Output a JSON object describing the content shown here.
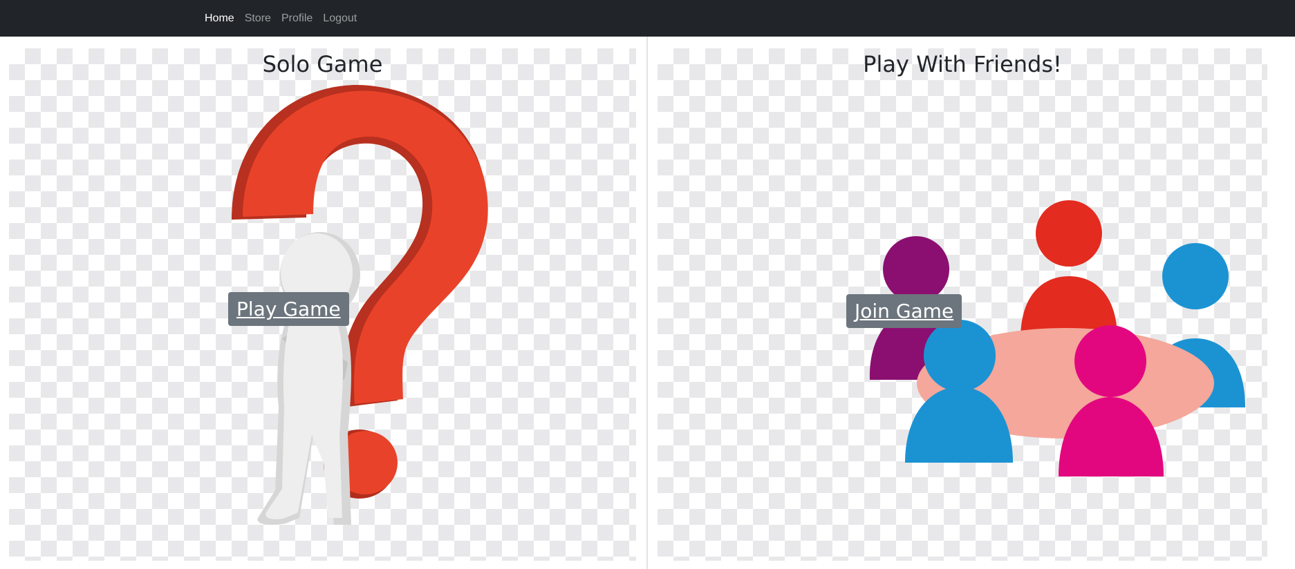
{
  "nav": {
    "links": [
      {
        "label": "Home",
        "active": true
      },
      {
        "label": "Store",
        "active": false
      },
      {
        "label": "Profile",
        "active": false
      },
      {
        "label": "Logout",
        "active": false
      }
    ]
  },
  "solo": {
    "title": "Solo Game",
    "button_label": "Play Game",
    "image": "question-mark-person-illustration"
  },
  "friends": {
    "title": "Play With Friends!",
    "button_label": "Join Game",
    "image": "group-around-table-illustration"
  },
  "colors": {
    "navbar": "#212529",
    "button": "#6c757d",
    "question_red": "#e8432a",
    "purple": "#8b0f70",
    "red": "#e32b1f",
    "blue": "#1b93d3",
    "pink": "#e3077f",
    "table": "#f4a79a"
  }
}
